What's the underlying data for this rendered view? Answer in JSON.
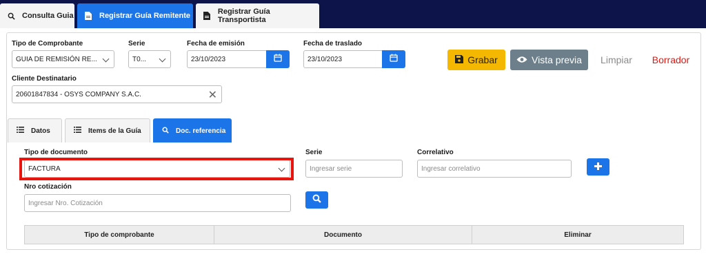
{
  "nav": {
    "tabs": [
      {
        "label": "Consulta Guia",
        "icon": "search-icon"
      },
      {
        "label": "Registrar Guía Remitente",
        "icon": "document-icon"
      },
      {
        "label": "Registrar Guía Transportista",
        "icon": "document-icon"
      }
    ]
  },
  "header": {
    "tipo_comprobante": {
      "label": "Tipo de Comprobante",
      "value": "GUIA DE REMISIÓN RE..."
    },
    "serie": {
      "label": "Serie",
      "value": "T0..."
    },
    "fecha_emision": {
      "label": "Fecha de emisión",
      "value": "23/10/2023"
    },
    "fecha_traslado": {
      "label": "Fecha de traslado",
      "value": "23/10/2023"
    },
    "cliente": {
      "label": "Cliente Destinatario",
      "value": "20601847834 - OSYS COMPANY S.A.C."
    }
  },
  "actions": {
    "grabar": "Grabar",
    "vista_previa": "Vista previa",
    "limpiar": "Limpiar",
    "borrador": "Borrador"
  },
  "subtabs": [
    {
      "label": "Datos",
      "icon": "list-icon"
    },
    {
      "label": "Items de la Guía",
      "icon": "list-icon"
    },
    {
      "label": "Doc. referencia",
      "icon": "search-icon"
    }
  ],
  "docref": {
    "tipo_documento": {
      "label": "Tipo de documento",
      "value": "FACTURA"
    },
    "serie": {
      "label": "Serie",
      "placeholder": "Ingresar serie"
    },
    "correlativo": {
      "label": "Correlativo",
      "placeholder": "Ingresar correlativo"
    },
    "nro_cotizacion": {
      "label": "Nro cotización",
      "placeholder": "Ingresar Nro. Cotización"
    }
  },
  "table": {
    "columns": [
      "Tipo de comprobante",
      "Documento",
      "Eliminar"
    ]
  },
  "colors": {
    "nav_bg": "#0d1449",
    "primary": "#1b75e8",
    "warning": "#f5b800",
    "secondary": "#6c7f8a",
    "danger": "#e8150f",
    "muted": "#8a8a8a"
  }
}
